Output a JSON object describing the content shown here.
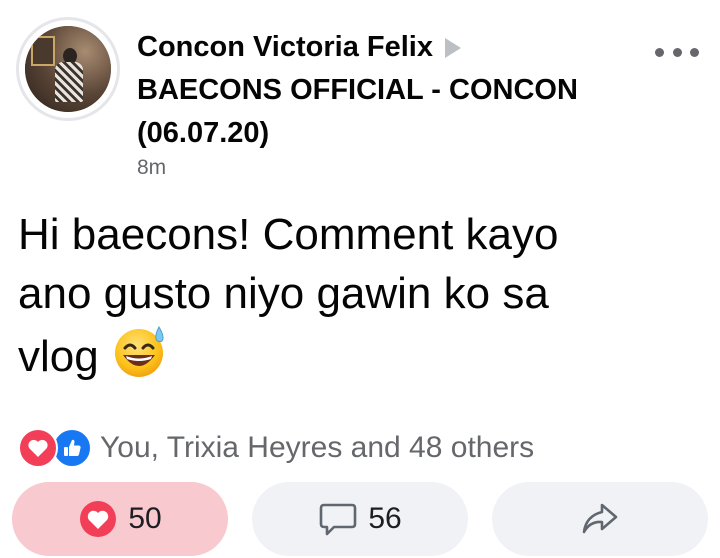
{
  "post": {
    "author": "Concon Victoria Felix",
    "group_line1": "BAECONS OFFICIAL - CONCON",
    "group_line2": "(06.07.20)",
    "time": "8m",
    "text_line1": "Hi baecons! Comment kayo",
    "text_line2": "ano gusto niyo gawin ko sa",
    "text_line3": "vlog",
    "emoji": "grinning-face-with-sweat"
  },
  "reactions": {
    "summary": "You, Trixia Heyres and 48 others",
    "types": [
      "love",
      "like"
    ]
  },
  "actions": {
    "react_count": "50",
    "comment_count": "56"
  },
  "colors": {
    "text": "#050505",
    "secondary": "#65676b",
    "love": "#f33e58",
    "like": "#1877f2",
    "react_button_bg": "#f8c9cf",
    "button_bg": "#f0f2f5"
  }
}
